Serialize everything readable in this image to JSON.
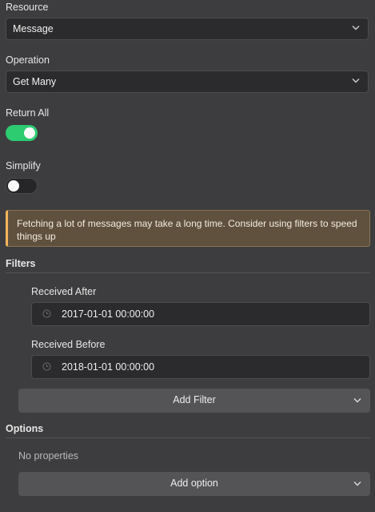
{
  "resource": {
    "label": "Resource",
    "value": "Message"
  },
  "operation": {
    "label": "Operation",
    "value": "Get Many"
  },
  "return_all": {
    "label": "Return All",
    "enabled": true
  },
  "simplify": {
    "label": "Simplify",
    "enabled": false
  },
  "notice": {
    "text": "Fetching a lot of messages may take a long time. Consider using filters to speed things up"
  },
  "filters": {
    "title": "Filters",
    "received_after": {
      "label": "Received After",
      "value": "2017-01-01 00:00:00"
    },
    "received_before": {
      "label": "Received Before",
      "value": "2018-01-01 00:00:00"
    },
    "add_label": "Add Filter"
  },
  "options": {
    "title": "Options",
    "empty_text": "No properties",
    "add_label": "Add option"
  },
  "colors": {
    "toggle_on": "#2dcc71",
    "notice_accent": "#f4b55c"
  }
}
